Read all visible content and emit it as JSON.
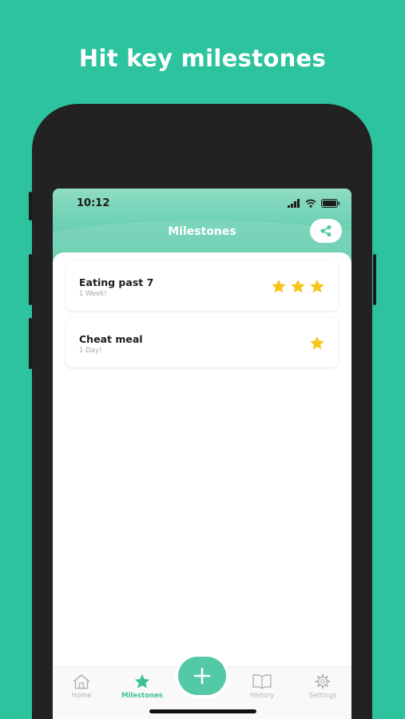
{
  "headline": "Hit key milestones",
  "status_bar": {
    "time": "10:12"
  },
  "header": {
    "title": "Milestones",
    "share_icon": "share-icon"
  },
  "milestones": [
    {
      "title": "Eating past 7",
      "subtitle": "1 Week!",
      "stars": 3
    },
    {
      "title": "Cheat meal",
      "subtitle": "1 Day!",
      "stars": 1
    }
  ],
  "tabbar": {
    "active": "Milestones",
    "items": [
      {
        "label": "Home",
        "icon": "home-icon"
      },
      {
        "label": "Milestones",
        "icon": "star-icon"
      },
      {
        "label": "History",
        "icon": "book-icon"
      },
      {
        "label": "Settings",
        "icon": "gear-icon"
      }
    ],
    "fab_icon": "plus-icon"
  },
  "colors": {
    "background": "#2ec39f",
    "accent": "#53c9a6",
    "star": "#f5c518",
    "phone": "#222222"
  }
}
